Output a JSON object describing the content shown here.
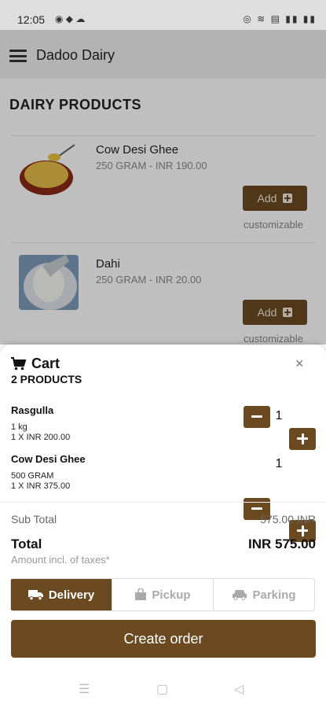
{
  "status": {
    "time": "12:05",
    "left_icons": "◉ ◆ ☁",
    "right_icons": "◎ ≋ ▤ ▮▮ ▮▮"
  },
  "appbar": {
    "title": "Dadoo Dairy"
  },
  "section": {
    "title": "DAIRY PRODUCTS"
  },
  "products": [
    {
      "name": "Cow Desi Ghee",
      "sub": "250 GRAM - INR 190.00",
      "add_label": "Add",
      "note": "customizable"
    },
    {
      "name": "Dahi",
      "sub": "250 GRAM - INR 20.00",
      "add_label": "Add",
      "note": "customizable"
    }
  ],
  "cart": {
    "title": "Cart",
    "count": "2 PRODUCTS",
    "close": "×",
    "items": [
      {
        "name": "Rasgulla",
        "unit": "1 kg",
        "price": "1 X INR 200.00",
        "qty": "1"
      },
      {
        "name": "Cow Desi Ghee",
        "unit": "500 GRAM",
        "price": "1 X INR 375.00",
        "qty": "1"
      }
    ],
    "subtotal_label": "Sub Total",
    "subtotal_value": "575.00 INR",
    "total_label": "Total",
    "total_value": "INR 575.00",
    "tax_note": "Amount incl. of taxes*",
    "options": [
      "Delivery",
      "Pickup",
      "Parking"
    ],
    "selected_option": "Delivery",
    "create_label": "Create order"
  },
  "colors": {
    "accent": "#6b4a22"
  }
}
